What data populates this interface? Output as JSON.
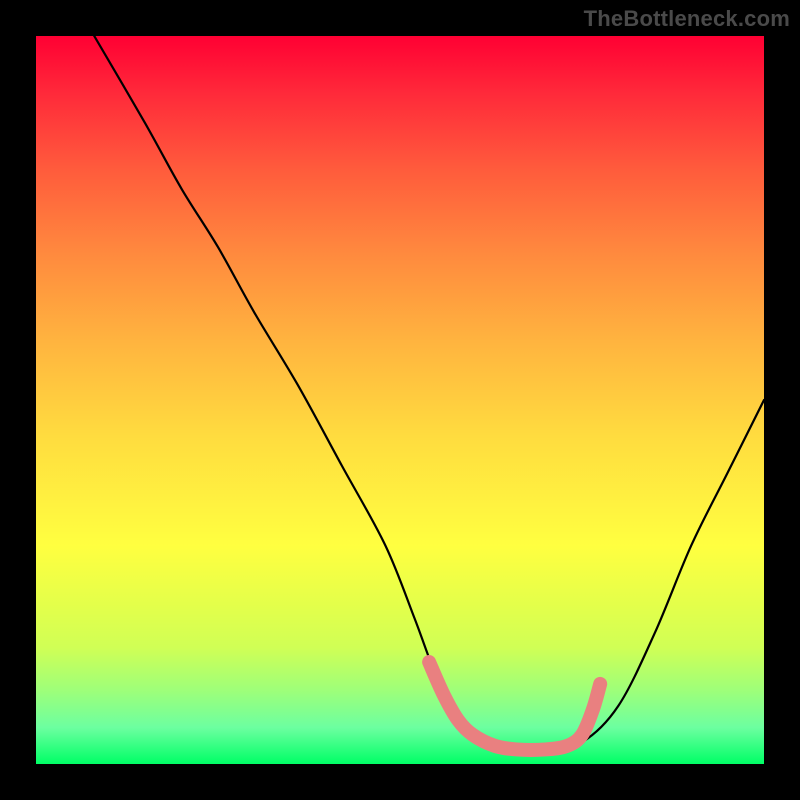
{
  "watermark": "TheBottleneck.com",
  "chart_data": {
    "type": "line",
    "title": "",
    "xlabel": "",
    "ylabel": "",
    "xlim": [
      0,
      100
    ],
    "ylim": [
      0,
      100
    ],
    "series": [
      {
        "name": "black-curve",
        "x": [
          8,
          15,
          20,
          25,
          30,
          36,
          42,
          48,
          52,
          55,
          58,
          61,
          65,
          70,
          75,
          80,
          85,
          90,
          95,
          100
        ],
        "y": [
          100,
          88,
          79,
          71,
          62,
          52,
          41,
          30,
          20,
          12,
          6,
          3,
          2,
          2,
          3,
          8,
          18,
          30,
          40,
          50
        ]
      },
      {
        "name": "pink-segment",
        "x": [
          54,
          56,
          58,
          60,
          63,
          66,
          70,
          73,
          75,
          76.5,
          77.5
        ],
        "y": [
          14,
          9.5,
          6,
          4,
          2.5,
          2,
          2,
          2.5,
          4,
          7.5,
          11
        ]
      }
    ],
    "colors": {
      "black_curve": "#000000",
      "pink_segment": "#e98080",
      "gradient_top": "#ff0033",
      "gradient_bottom": "#00ff66"
    }
  }
}
